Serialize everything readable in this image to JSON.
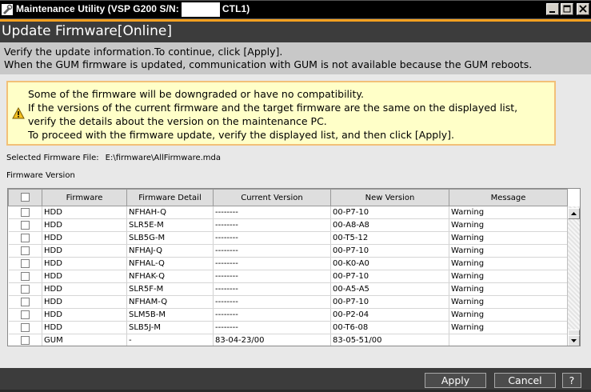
{
  "window": {
    "title_before": "Maintenance Utility (VSP G200 S/N:",
    "title_after": "CTL1)"
  },
  "header": {
    "title": "Update Firmware[Online]"
  },
  "info": {
    "line1": "Verify the update information.To continue, click [Apply].",
    "line2": "When the GUM firmware is updated, communication with GUM is not available because the GUM reboots."
  },
  "warning": {
    "icon": "warning-triangle-icon",
    "lines": [
      "Some of the firmware will be downgraded or have no compatibility.",
      "If the versions of the current firmware and the target firmware are the same on the displayed list,",
      "verify the details about the version on the maintenance PC.",
      "To proceed with the firmware update, verify the displayed list, and then click [Apply]."
    ]
  },
  "selected_file": {
    "label": "Selected Firmware File:",
    "value": "E:\\firmware\\AllFirmware.mda"
  },
  "version_label": "Firmware Version",
  "table": {
    "columns": [
      "Firmware",
      "Firmware Detail",
      "Current Version",
      "New Version",
      "Message"
    ],
    "rows": [
      {
        "firmware": "HDD",
        "detail": "NFHAH-Q",
        "current": "--------",
        "new": "00-P7-10",
        "message": "Warning"
      },
      {
        "firmware": "HDD",
        "detail": "SLR5E-M",
        "current": "--------",
        "new": "00-A8-A8",
        "message": "Warning"
      },
      {
        "firmware": "HDD",
        "detail": "SLB5G-M",
        "current": "--------",
        "new": "00-T5-12",
        "message": "Warning"
      },
      {
        "firmware": "HDD",
        "detail": "NFHAJ-Q",
        "current": "--------",
        "new": "00-P7-10",
        "message": "Warning"
      },
      {
        "firmware": "HDD",
        "detail": "NFHAL-Q",
        "current": "--------",
        "new": "00-K0-A0",
        "message": "Warning"
      },
      {
        "firmware": "HDD",
        "detail": "NFHAK-Q",
        "current": "--------",
        "new": "00-P7-10",
        "message": "Warning"
      },
      {
        "firmware": "HDD",
        "detail": "SLR5F-M",
        "current": "--------",
        "new": "00-A5-A5",
        "message": "Warning"
      },
      {
        "firmware": "HDD",
        "detail": "NFHAM-Q",
        "current": "--------",
        "new": "00-P7-10",
        "message": "Warning"
      },
      {
        "firmware": "HDD",
        "detail": "SLM5B-M",
        "current": "--------",
        "new": "00-P2-04",
        "message": "Warning"
      },
      {
        "firmware": "HDD",
        "detail": "SLB5J-M",
        "current": "--------",
        "new": "00-T6-08",
        "message": "Warning"
      },
      {
        "firmware": "GUM",
        "detail": "-",
        "current": "83-04-23/00",
        "new": "83-05-51/00",
        "message": ""
      }
    ]
  },
  "buttons": {
    "apply": "Apply",
    "cancel": "Cancel",
    "help": "?"
  },
  "colors": {
    "header_bg": "#3c3c3c",
    "header_accent": "#f4a020",
    "warning_bg": "#ffffc8",
    "warning_border": "#f2c078"
  }
}
